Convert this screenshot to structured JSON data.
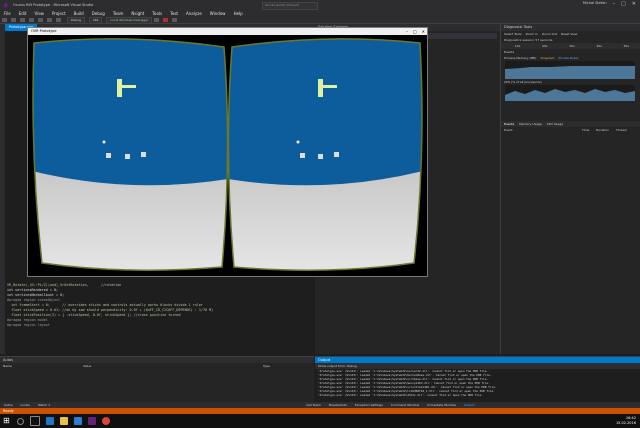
{
  "window": {
    "title": "Oculus Rift Prototype - Microsoft Visual Studio",
    "quick_launch": "Quick Launch (Ctrl+Q)",
    "user": "Michal Stefan"
  },
  "menu": [
    "File",
    "Edit",
    "View",
    "Project",
    "Build",
    "Debug",
    "Team",
    "Nsight",
    "Tools",
    "Test",
    "Analyze",
    "Window",
    "Help"
  ],
  "toolbar": {
    "config": "Debug",
    "platform": "x64",
    "run": "Local Windows Debugger"
  },
  "editor": {
    "tabs": [
      "Prototype.cpp"
    ],
    "code_lines": [
      {
        "n": "",
        "t": "VR_Rotate(-(D::Pi/2)(wnd)_VrGetRotation,      //rotation"
      },
      {
        "n": "",
        "t": ""
      },
      {
        "n": "",
        "t": "int verticesRendered = 0;"
      },
      {
        "n": "",
        "t": "int verticesNormalCount = 0;"
      },
      {
        "n": "",
        "t": ""
      },
      {
        "n": "",
        "t": "#pragma region sceneObject"
      },
      {
        "n": "",
        "t": ""
      },
      {
        "n": "",
        "t": "  int frameStart = 0;      // overrides sticks and controls actually works blocks divide 1 ruler"
      },
      {
        "n": "",
        "t": "  float stickSpeed = 0.01; //ok by sad should perpendicity: 0.0f + (0xFF_CD_C2C0FF_DEPENDS) : 1/70 M)"
      },
      {
        "n": "",
        "t": "  float stickPosition(3) = { -stickSpeed, 0.0f, stickSpeed }; //cross positive turned"
      },
      {
        "n": "",
        "t": ""
      },
      {
        "n": "",
        "t": "#pragma region model"
      },
      {
        "n": "",
        "t": ""
      },
      {
        "n": "",
        "t": "#pragma region layout"
      }
    ]
  },
  "vr_window": {
    "title": "OVR Prototype"
  },
  "middle_panel": {
    "title": "Solution Explorer",
    "search": "Search Solution Explorer"
  },
  "diagnostics": {
    "title": "Diagnostic Tools",
    "toolbar": [
      "Select Tools",
      "Zoom In",
      "Zoom Out",
      "Reset View"
    ],
    "session": "Diagnostics session: 57 seconds",
    "timeline": [
      "10s",
      "20s",
      "30s",
      "40s",
      "50s"
    ],
    "events": "Events",
    "memory": "Process Memory (MB)",
    "memory_legend": [
      "Snapshot",
      "Private Bytes"
    ],
    "cpu": "CPU (% of all processors)",
    "tabs": [
      "Events",
      "Memory Usage",
      "CPU Usage"
    ],
    "cols": [
      "Event",
      "Time",
      "Duration",
      "Thread"
    ]
  },
  "autos": {
    "title": "Autos",
    "cols": [
      "Name",
      "Value",
      "Type"
    ]
  },
  "output": {
    "title": "Output",
    "show_from": "Show output from:  Debug",
    "lines": [
      "'Prototype.exe' (Win32): Loaded 'C:\\Windows\\System32\\kernel32.dll'. Cannot find or open the PDB file.",
      "'Prototype.exe' (Win32): Loaded 'C:\\Windows\\System32\\KernelBase.dll'. Cannot find or open the PDB file.",
      "'Prototype.exe' (Win32): Loaded 'C:\\Windows\\System32\\ucrtbase.dll'. Cannot find or open the PDB file.",
      "'Prototype.exe' (Win32): Loaded 'C:\\Windows\\System32\\msvcp140d.dll'. Cannot find or open the PDB file.",
      "'Prototype.exe' (Win32): Loaded 'C:\\Windows\\System32\\vcruntime140d.dll'. Cannot find or open the PDB file.",
      "'Prototype.exe' (Win32): Loaded 'C:\\Windows\\System32\\LibOVRRT64_1.dll'. Cannot find or open the PDB file.",
      "'Prototype.exe' (Win32): Loaded 'C:\\Windows\\System32\\d3d11.dll'. Cannot find or open the PDB file."
    ]
  },
  "bottom_tabs_left": [
    "Autos",
    "Locals",
    "Watch 1"
  ],
  "bottom_tabs_right": [
    "Call Stack",
    "Breakpoints",
    "Exception Settings",
    "Command Window",
    "Immediate Window",
    "Output"
  ],
  "status": "Ready",
  "taskbar": {
    "time": "16:42",
    "date": "15.02.2016"
  },
  "colors": {
    "accent": "#007acc",
    "status": "#ca5100",
    "sky": "#0d5c9c",
    "floor": "#cfcfcf",
    "lens_frame": "#6b7a2a"
  }
}
